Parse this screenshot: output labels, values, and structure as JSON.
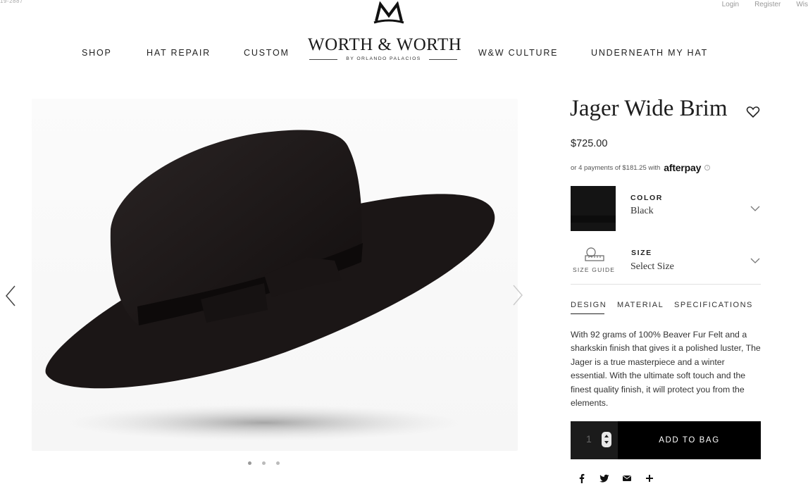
{
  "header": {
    "phone": "19-2887",
    "utility": {
      "login": "Login",
      "register": "Register",
      "wish": "Wis"
    },
    "nav_left": [
      "SHOP",
      "HAT REPAIR",
      "CUSTOM"
    ],
    "nav_right": [
      "W&W CULTURE",
      "UNDERNEATH MY HAT"
    ],
    "logo": {
      "wordmark": "WORTH & WORTH",
      "tagline": "BY ORLANDO PALACIOS"
    }
  },
  "gallery": {
    "image_count": 3,
    "active_index": 0,
    "prev_icon": "chevron-left-icon",
    "next_icon": "chevron-right-icon"
  },
  "product": {
    "title": "Jager Wide Brim",
    "price": "$725.00",
    "afterpay_text": "or 4 payments of $181.25 with",
    "afterpay_brand": "afterpay",
    "color_label": "COLOR",
    "color_value": "Black",
    "size_label": "SIZE",
    "size_value": "Select Size",
    "size_guide": "SIZE GUIDE",
    "tabs": [
      "DESIGN",
      "MATERIAL",
      "SPECIFICATIONS"
    ],
    "active_tab": "DESIGN",
    "description": "With 92 grams of 100% Beaver Fur Felt and a sharkskin finish that gives it a polished luster, The Jager is a true masterpiece and a winter essential. With the ultimate soft touch and the finest quality finish, it will protect you from the elements.",
    "quantity": "1",
    "add_to_bag": "ADD TO BAG"
  },
  "social_icons": [
    "facebook-icon",
    "twitter-icon",
    "email-icon",
    "plus-icon"
  ],
  "colors": {
    "text": "#222222",
    "button": "#000000",
    "swatch": "#141414"
  }
}
